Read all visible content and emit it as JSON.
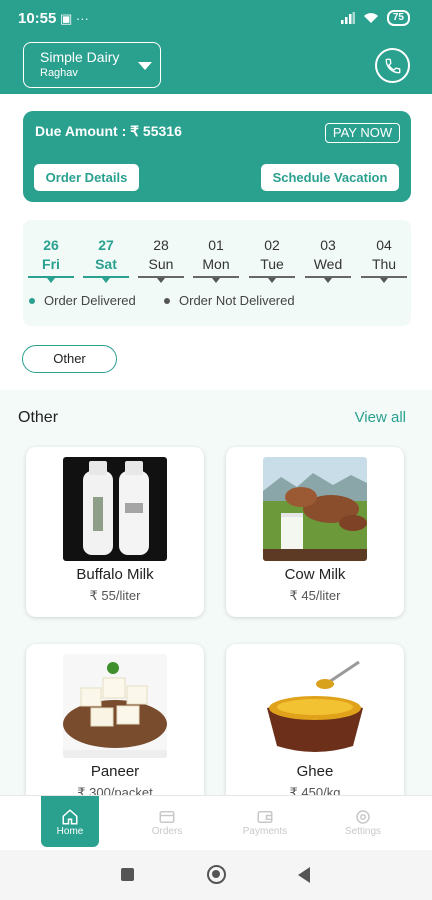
{
  "status_bar": {
    "time": "10:55",
    "left_icons": "▣ ···",
    "battery": "75"
  },
  "header": {
    "store_name": "Simple Dairy",
    "user_name": "Raghav"
  },
  "due": {
    "label": "Due Amount : ₹ 55316",
    "pay_now": "PAY NOW",
    "order_details": "Order Details",
    "schedule_vacation": "Schedule Vacation"
  },
  "calendar": {
    "days": [
      {
        "date": "26",
        "weekday": "Fri",
        "active": true
      },
      {
        "date": "27",
        "weekday": "Sat",
        "active": true
      },
      {
        "date": "28",
        "weekday": "Sun",
        "active": false
      },
      {
        "date": "01",
        "weekday": "Mon",
        "active": false
      },
      {
        "date": "02",
        "weekday": "Tue",
        "active": false
      },
      {
        "date": "03",
        "weekday": "Wed",
        "active": false
      },
      {
        "date": "04",
        "weekday": "Thu",
        "active": false
      }
    ],
    "legend_delivered": "Order Delivered",
    "legend_not_delivered": "Order Not Delivered"
  },
  "filter_chip": "Other",
  "section": {
    "title": "Other",
    "view_all": "View all"
  },
  "products": [
    {
      "name": "Buffalo Milk",
      "price": "₹ 55/liter"
    },
    {
      "name": "Cow Milk",
      "price": "₹ 45/liter"
    },
    {
      "name": "Paneer",
      "price": "₹ 300/packet"
    },
    {
      "name": "Ghee",
      "price": "₹ 450/kg"
    }
  ],
  "bottom_nav": [
    {
      "label": "Home",
      "icon": "home-icon",
      "active": true
    },
    {
      "label": "Orders",
      "icon": "orders-icon",
      "active": false
    },
    {
      "label": "Payments",
      "icon": "wallet-icon",
      "active": false
    },
    {
      "label": "Settings",
      "icon": "gear-icon",
      "active": false
    }
  ],
  "colors": {
    "accent": "#2aa08f",
    "delivered": "#2aa08f",
    "not_delivered": "#555555"
  }
}
